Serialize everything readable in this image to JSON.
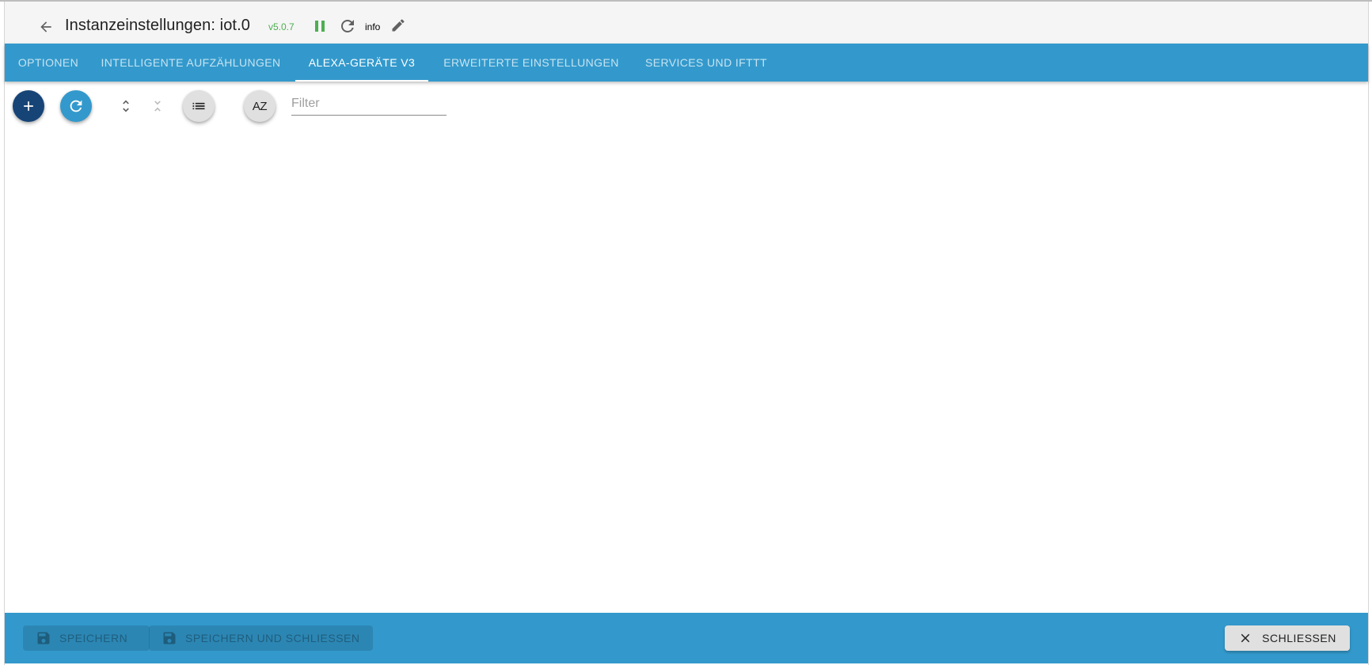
{
  "header": {
    "title": "Instanzeinstellungen: iot.0",
    "version": "v5.0.7",
    "loglevel": "info",
    "icons": {
      "back": "arrow-left-icon",
      "pause": "pause-icon",
      "reload": "reload-icon",
      "edit": "pencil-icon"
    },
    "status_color": "#4caf50"
  },
  "tabs": [
    {
      "label": "OPTIONEN",
      "active": false
    },
    {
      "label": "INTELLIGENTE AUFZÄHLUNGEN",
      "active": false
    },
    {
      "label": "ALEXA-GERÄTE V3",
      "active": true
    },
    {
      "label": "ERWEITERTE EINSTELLUNGEN",
      "active": false
    },
    {
      "label": "SERVICES UND IFTTT",
      "active": false
    }
  ],
  "toolbar": {
    "icons": {
      "add": "plus-icon",
      "refresh": "refresh-icon",
      "expand": "unfold-more-icon",
      "collapse": "unfold-less-icon",
      "list": "list-icon",
      "sort": "sort-alphabetical-icon"
    },
    "sort_label": "AZ",
    "filter_placeholder": "Filter",
    "filter_value": ""
  },
  "footer": {
    "save_label": "SPEICHERN",
    "save_close_label": "SPEICHERN UND SCHLIESSEN",
    "close_label": "SCHLIESSEN",
    "icons": {
      "save": "floppy-disk-icon",
      "close": "close-icon"
    }
  },
  "colors": {
    "primary": "#3399cc",
    "dark_primary": "#164477",
    "header_bg": "#f5f5f5"
  }
}
